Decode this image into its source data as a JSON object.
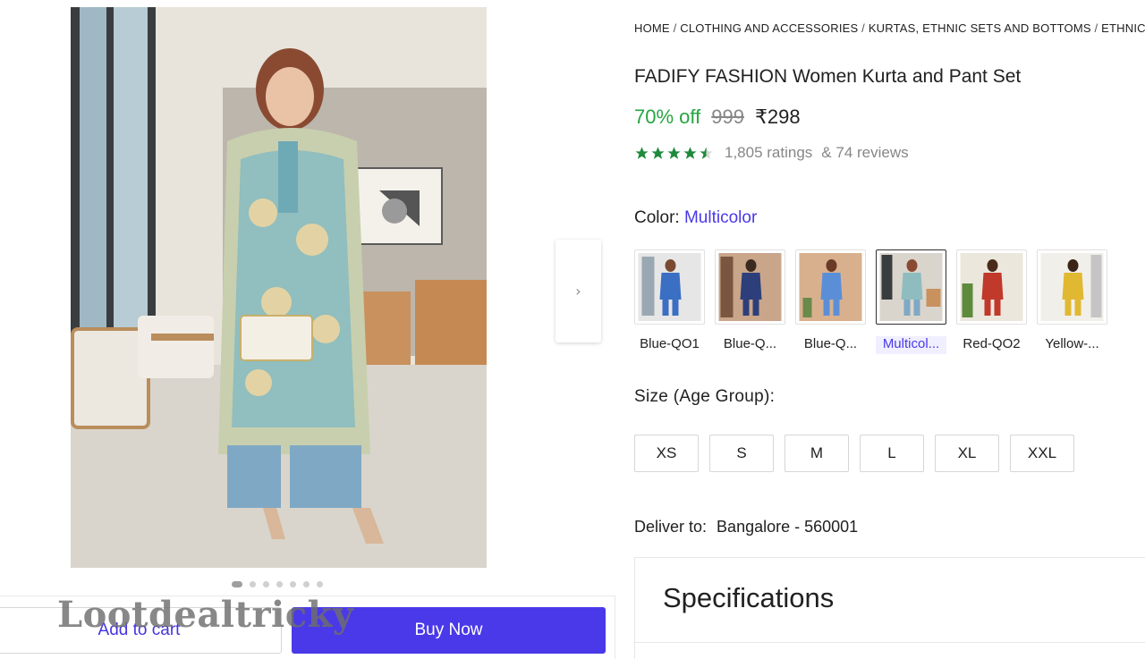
{
  "gallery": {
    "active_dot": 0,
    "dot_count": 7,
    "next_icon": "chevron-right-icon"
  },
  "actions": {
    "add_to_cart": "Add to cart",
    "buy_now": "Buy Now"
  },
  "watermark": "Lootdealtricky",
  "breadcrumb": [
    "HOME",
    "CLOTHING AND ACCESSORIES",
    "KURTAS, ETHNIC SETS AND BOTTOMS",
    "ETHNIC SETS"
  ],
  "product": {
    "title": "FADIFY FASHION Women Kurta and Pant Set",
    "discount": "70% off",
    "mrp": "999",
    "price": "₹298",
    "rating": 4.5,
    "ratings_text": "1,805 ratings",
    "reviews_text": "& 74 reviews"
  },
  "color": {
    "label": "Color:",
    "selected": "Multicolor",
    "options": [
      {
        "label": "Blue-QO1",
        "tone": "#3a6fc4"
      },
      {
        "label": "Blue-Q...",
        "tone": "#2d3f7a"
      },
      {
        "label": "Blue-Q...",
        "tone": "#5a8fd8"
      },
      {
        "label": "Multicol...",
        "tone": "#6fa6a8"
      },
      {
        "label": "Red-QO2",
        "tone": "#c0392b"
      },
      {
        "label": "Yellow-...",
        "tone": "#e1b832"
      }
    ]
  },
  "size": {
    "label": "Size (Age Group):",
    "options": [
      "XS",
      "S",
      "M",
      "L",
      "XL",
      "XXL"
    ]
  },
  "delivery": {
    "label": "Deliver to:",
    "location": "Bangalore - 560001"
  },
  "specifications": {
    "title": "Specifications"
  },
  "colors": {
    "accent": "#4a39e8",
    "discount_green": "#26a541",
    "star_green": "#1e8a3a"
  }
}
